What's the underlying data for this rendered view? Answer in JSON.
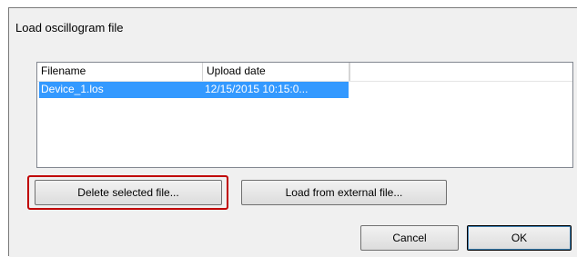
{
  "window": {
    "title": "Load oscillogram file"
  },
  "listview": {
    "columns": [
      "Filename",
      "Upload date"
    ],
    "rows": [
      {
        "filename": "Device_1.los",
        "upload_date": "12/15/2015 10:15:0...",
        "selected": true
      }
    ]
  },
  "buttons": {
    "delete": "Delete selected file...",
    "load_external": "Load from external file...",
    "cancel": "Cancel",
    "ok": "OK"
  },
  "colors": {
    "selection": "#3399ff",
    "highlight_box": "#c00000",
    "dialog_bg": "#f0f0f0"
  }
}
